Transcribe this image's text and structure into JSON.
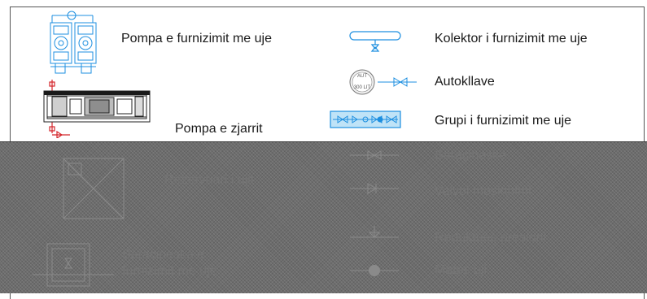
{
  "legend": {
    "pompa_furnizimit": "Pompa e furnizimit me uje",
    "pompa_zjarrit": "Pompa e zjarrit",
    "kolektor": "Kolektor i furnizimit me uje",
    "autokllave": "Autokllave",
    "autokllave_tag": "AUT",
    "autokllave_capacity": "300 LIT",
    "grupi": "Grupi i furnizimit me uje",
    "saracineske": "Saraçineske",
    "valvol": "Valvol moskthimi",
    "reduktues": "Reduktues presioni",
    "mates": "Mates uji",
    "rezervuari": "Rezervuari i ujit",
    "saracineska_line1": "Saracineska e",
    "saracineska_line2": "furnizimit me uje"
  },
  "colors": {
    "symbol_blue": "#1d8fe0",
    "symbol_red": "#d4262b",
    "overlay": "#6d6d6d"
  }
}
